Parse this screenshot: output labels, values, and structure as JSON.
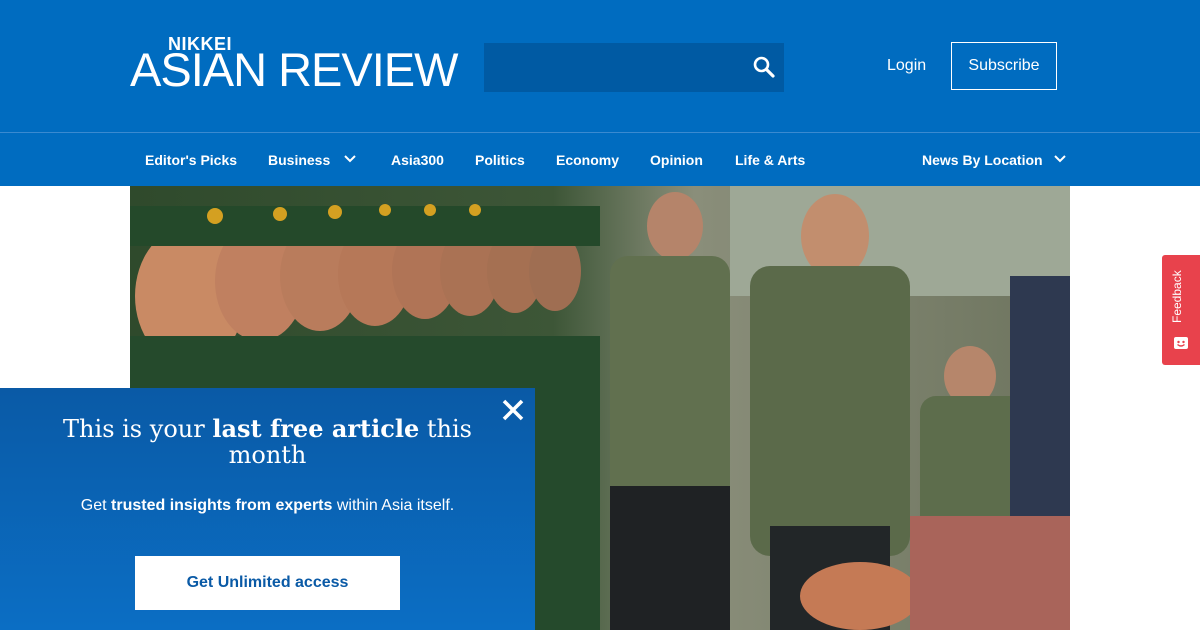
{
  "brand": {
    "logo_top": "NIKKEI",
    "logo_main": "ASIAN REVIEW",
    "primary_color": "#006cc0"
  },
  "header": {
    "search_placeholder": "",
    "search_icon": "search-icon",
    "login_label": "Login",
    "subscribe_label": "Subscribe"
  },
  "nav": {
    "items": [
      {
        "label": "Editor's Picks"
      },
      {
        "label": "Business",
        "has_dropdown": true
      },
      {
        "label": "Asia300"
      },
      {
        "label": "Politics"
      },
      {
        "label": "Economy"
      },
      {
        "label": "Opinion"
      },
      {
        "label": "Life & Arts"
      },
      {
        "label": "News By Location",
        "has_dropdown": true
      }
    ]
  },
  "feedback": {
    "label": "Feedback",
    "color": "#e8424c"
  },
  "paywall": {
    "title_pre": "This is your ",
    "title_bold": "last free article",
    "title_post": " this month",
    "sub_pre": "Get ",
    "sub_bold": "trusted insights from experts",
    "sub_post": " within Asia itself.",
    "cta_label": "Get Unlimited access",
    "close_icon": "close-icon"
  }
}
